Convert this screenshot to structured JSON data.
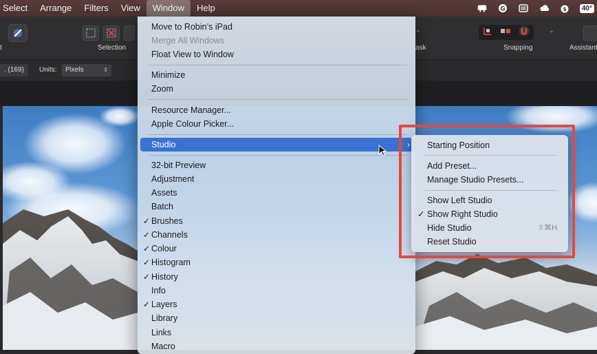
{
  "menubar": {
    "items": [
      "Select",
      "Arrange",
      "Filters",
      "View",
      "Window",
      "Help"
    ],
    "active": "Window",
    "status_icons": [
      "bulldog-icon",
      "circle-g-icon",
      "window-icon",
      "cloud-weather-icon",
      "money-bag-icon"
    ],
    "temperature": "40°"
  },
  "toolbar": {
    "selection_label": "Selection",
    "mask_label": "ask",
    "snapping_label": "Snapping",
    "assistant_label": "Assistant",
    "left_fragment_label": "t"
  },
  "contextbar": {
    "left_value": ". (169)",
    "units_label": "Units:",
    "units_value": "Pixels"
  },
  "window_menu": {
    "items": [
      {
        "label": "Move to Robin’s iPad",
        "enabled": true
      },
      {
        "label": "Merge All Windows",
        "enabled": false
      },
      {
        "label": "Float View to Window",
        "enabled": true
      },
      {
        "label": "Minimize",
        "enabled": true
      },
      {
        "label": "Zoom",
        "enabled": true
      },
      {
        "label": "Resource Manager...",
        "enabled": true
      },
      {
        "label": "Apple Colour Picker...",
        "enabled": true
      },
      {
        "label": "Studio",
        "enabled": true,
        "highlighted": true,
        "has_submenu": true
      },
      {
        "label": "32-bit Preview",
        "checked": false
      },
      {
        "label": "Adjustment",
        "checked": false
      },
      {
        "label": "Assets",
        "checked": false
      },
      {
        "label": "Batch",
        "checked": false
      },
      {
        "label": "Brushes",
        "checked": true
      },
      {
        "label": "Channels",
        "checked": true
      },
      {
        "label": "Colour",
        "checked": true
      },
      {
        "label": "Histogram",
        "checked": true
      },
      {
        "label": "History",
        "checked": true
      },
      {
        "label": "Info",
        "checked": false
      },
      {
        "label": "Layers",
        "checked": true
      },
      {
        "label": "Library",
        "checked": false
      },
      {
        "label": "Links",
        "checked": false
      },
      {
        "label": "Macro",
        "checked": false
      }
    ],
    "check_glyph": "✓",
    "submenu_arrow": "›",
    "highlight_color": "#3a72d2"
  },
  "studio_submenu": {
    "items": [
      {
        "label": "Starting Position",
        "checked": false,
        "shortcut": ""
      },
      {
        "label": "Add Preset...",
        "checked": false,
        "shortcut": ""
      },
      {
        "label": "Manage Studio Presets...",
        "checked": false,
        "shortcut": ""
      },
      {
        "label": "Show Left Studio",
        "checked": false,
        "shortcut": ""
      },
      {
        "label": "Show Right Studio",
        "checked": true,
        "shortcut": ""
      },
      {
        "label": "Hide Studio",
        "checked": false,
        "shortcut": "⇧⌘H"
      },
      {
        "label": "Reset Studio",
        "checked": false,
        "shortcut": ""
      }
    ],
    "annotation_color": "#e8473b"
  }
}
